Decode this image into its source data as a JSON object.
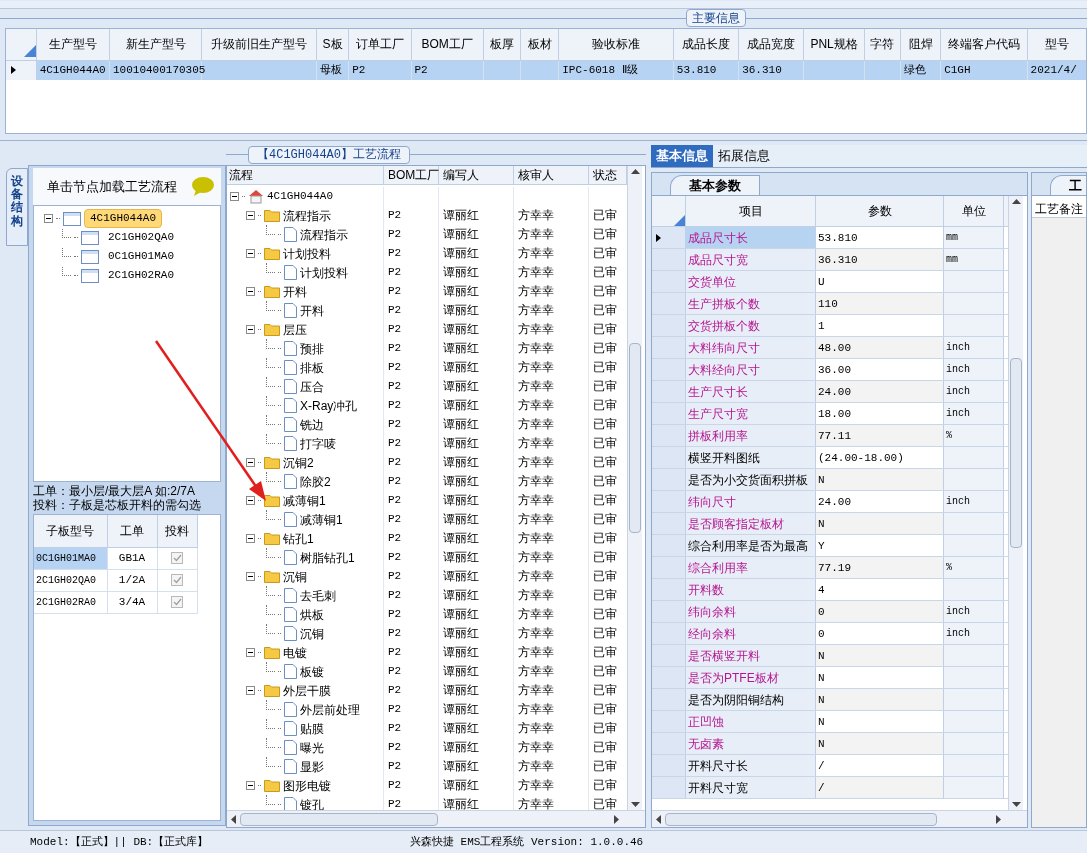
{
  "main_info": {
    "title": "主要信息",
    "columns": [
      "生产型号",
      "新生产型号",
      "升级前旧生产型号",
      "S板",
      "订单工厂",
      "BOM工厂",
      "板厚",
      "板材",
      "验收标准",
      "成品长度",
      "成品宽度",
      "PNL规格",
      "字符",
      "阻焊",
      "终端客户代码",
      "型号"
    ],
    "rows": [
      {
        "selected": true,
        "cells": [
          "4C1GH044A0",
          "10010400170305",
          null,
          "母板",
          "P2",
          "P2",
          null,
          null,
          "IPC-6018 Ⅱ级",
          "53.810",
          "36.310",
          null,
          null,
          "绿色",
          "C1GH",
          "2021/4/"
        ]
      }
    ]
  },
  "structure": {
    "tab": "设备结构",
    "hint": "单击节点加载工艺流程",
    "tree": [
      {
        "label": "4C1GH044A0",
        "selected": true,
        "expanded": true,
        "children": [
          {
            "label": "2C1GH02QA0",
            "selected": false
          },
          {
            "label": "0C1GH01MA0",
            "selected": false
          },
          {
            "label": "2C1GH02RA0",
            "selected": false
          }
        ]
      }
    ],
    "notes": [
      "工单：最小层/最大层A 如:2/7A",
      "投料：子板是芯板开料的需勾选"
    ],
    "sub_boards": {
      "columns": [
        "子板型号",
        "工单",
        "投料"
      ],
      "rows": [
        {
          "model": "0C1GH01MA0",
          "order": "GB1A",
          "checked": true,
          "selected": true
        },
        {
          "model": "2C1GH02QA0",
          "order": "1/2A",
          "checked": true,
          "selected": false
        },
        {
          "model": "2C1GH02RA0",
          "order": "3/4A",
          "checked": true,
          "selected": false
        }
      ]
    }
  },
  "process": {
    "title": "【4C1GH044A0】工艺流程",
    "columns": [
      "流程",
      "BOM工厂",
      "编写人",
      "核审人",
      "状态"
    ],
    "tree": [
      {
        "label": "4C1GH044A0",
        "kind": "root",
        "expanded": true,
        "children": [
          {
            "label": "流程指示",
            "kind": "folder",
            "expanded": true,
            "bom": "P2",
            "writer": "谭丽红",
            "reviewer": "方幸幸",
            "status": "已审",
            "children": [
              {
                "label": "流程指示",
                "kind": "step",
                "bom": "P2",
                "writer": "谭丽红",
                "reviewer": "方幸幸",
                "status": "已审"
              }
            ]
          },
          {
            "label": "计划投料",
            "kind": "folder",
            "expanded": true,
            "bom": "P2",
            "writer": "谭丽红",
            "reviewer": "方幸幸",
            "status": "已审",
            "children": [
              {
                "label": "计划投料",
                "kind": "step",
                "bom": "P2",
                "writer": "谭丽红",
                "reviewer": "方幸幸",
                "status": "已审"
              }
            ]
          },
          {
            "label": "开料",
            "kind": "folder",
            "expanded": true,
            "bom": "P2",
            "writer": "谭丽红",
            "reviewer": "方幸幸",
            "status": "已审",
            "children": [
              {
                "label": "开料",
                "kind": "step",
                "bom": "P2",
                "writer": "谭丽红",
                "reviewer": "方幸幸",
                "status": "已审"
              }
            ]
          },
          {
            "label": "层压",
            "kind": "folder",
            "expanded": true,
            "bom": "P2",
            "writer": "谭丽红",
            "reviewer": "方幸幸",
            "status": "已审",
            "children": [
              {
                "label": "预排",
                "kind": "step",
                "bom": "P2",
                "writer": "谭丽红",
                "reviewer": "方幸幸",
                "status": "已审"
              },
              {
                "label": "排板",
                "kind": "step",
                "bom": "P2",
                "writer": "谭丽红",
                "reviewer": "方幸幸",
                "status": "已审"
              },
              {
                "label": "压合",
                "kind": "step",
                "bom": "P2",
                "writer": "谭丽红",
                "reviewer": "方幸幸",
                "status": "已审"
              },
              {
                "label": "X-Ray冲孔",
                "kind": "step",
                "bom": "P2",
                "writer": "谭丽红",
                "reviewer": "方幸幸",
                "status": "已审"
              },
              {
                "label": "铣边",
                "kind": "step",
                "bom": "P2",
                "writer": "谭丽红",
                "reviewer": "方幸幸",
                "status": "已审"
              },
              {
                "label": "打字唛",
                "kind": "step",
                "bom": "P2",
                "writer": "谭丽红",
                "reviewer": "方幸幸",
                "status": "已审"
              }
            ]
          },
          {
            "label": "沉铜2",
            "kind": "folder",
            "expanded": true,
            "bom": "P2",
            "writer": "谭丽红",
            "reviewer": "方幸幸",
            "status": "已审",
            "children": [
              {
                "label": "除胶2",
                "kind": "step",
                "bom": "P2",
                "writer": "谭丽红",
                "reviewer": "方幸幸",
                "status": "已审"
              }
            ]
          },
          {
            "label": "减薄铜1",
            "kind": "folder",
            "expanded": true,
            "bom": "P2",
            "writer": "谭丽红",
            "reviewer": "方幸幸",
            "status": "已审",
            "children": [
              {
                "label": "减薄铜1",
                "kind": "step",
                "bom": "P2",
                "writer": "谭丽红",
                "reviewer": "方幸幸",
                "status": "已审"
              }
            ]
          },
          {
            "label": "钻孔1",
            "kind": "folder",
            "expanded": true,
            "bom": "P2",
            "writer": "谭丽红",
            "reviewer": "方幸幸",
            "status": "已审",
            "children": [
              {
                "label": "树脂钻孔1",
                "kind": "step",
                "bom": "P2",
                "writer": "谭丽红",
                "reviewer": "方幸幸",
                "status": "已审"
              }
            ]
          },
          {
            "label": "沉铜",
            "kind": "folder",
            "expanded": true,
            "bom": "P2",
            "writer": "谭丽红",
            "reviewer": "方幸幸",
            "status": "已审",
            "children": [
              {
                "label": "去毛刺",
                "kind": "step",
                "bom": "P2",
                "writer": "谭丽红",
                "reviewer": "方幸幸",
                "status": "已审"
              },
              {
                "label": "烘板",
                "kind": "step",
                "bom": "P2",
                "writer": "谭丽红",
                "reviewer": "方幸幸",
                "status": "已审"
              },
              {
                "label": "沉铜",
                "kind": "step",
                "bom": "P2",
                "writer": "谭丽红",
                "reviewer": "方幸幸",
                "status": "已审"
              }
            ]
          },
          {
            "label": "电镀",
            "kind": "folder",
            "expanded": true,
            "bom": "P2",
            "writer": "谭丽红",
            "reviewer": "方幸幸",
            "status": "已审",
            "children": [
              {
                "label": "板镀",
                "kind": "step",
                "bom": "P2",
                "writer": "谭丽红",
                "reviewer": "方幸幸",
                "status": "已审"
              }
            ]
          },
          {
            "label": "外层干膜",
            "kind": "folder",
            "expanded": true,
            "bom": "P2",
            "writer": "谭丽红",
            "reviewer": "方幸幸",
            "status": "已审",
            "children": [
              {
                "label": "外层前处理",
                "kind": "step",
                "bom": "P2",
                "writer": "谭丽红",
                "reviewer": "方幸幸",
                "status": "已审"
              },
              {
                "label": "贴膜",
                "kind": "step",
                "bom": "P2",
                "writer": "谭丽红",
                "reviewer": "方幸幸",
                "status": "已审"
              },
              {
                "label": "曝光",
                "kind": "step",
                "bom": "P2",
                "writer": "谭丽红",
                "reviewer": "方幸幸",
                "status": "已审"
              },
              {
                "label": "显影",
                "kind": "step",
                "bom": "P2",
                "writer": "谭丽红",
                "reviewer": "方幸幸",
                "status": "已审"
              }
            ]
          },
          {
            "label": "图形电镀",
            "kind": "folder",
            "expanded": true,
            "bom": "P2",
            "writer": "谭丽红",
            "reviewer": "方幸幸",
            "status": "已审",
            "children": [
              {
                "label": "镀孔",
                "kind": "step",
                "bom": "P2",
                "writer": "谭丽红",
                "reviewer": "方幸幸",
                "status": "已审"
              }
            ]
          }
        ]
      }
    ]
  },
  "info": {
    "tabs": [
      {
        "label": "基本信息",
        "selected": true
      },
      {
        "label": "拓展信息",
        "selected": false
      }
    ],
    "params_tab": "基本参数",
    "columns": [
      "项目",
      "参数",
      "单位"
    ],
    "params": [
      {
        "item": "成品尺寸长",
        "value": "53.810",
        "unit": "mm",
        "highlighted": true,
        "selected": true
      },
      {
        "item": "成品尺寸宽",
        "value": "36.310",
        "unit": "mm",
        "highlighted": true,
        "selected": false
      },
      {
        "item": "交货单位",
        "value": "U",
        "highlighted": true,
        "selected": false
      },
      {
        "item": "生产拼板个数",
        "value": "110",
        "highlighted": true,
        "selected": false
      },
      {
        "item": "交货拼板个数",
        "value": "1",
        "highlighted": true,
        "selected": false
      },
      {
        "item": "大料纬向尺寸",
        "value": "48.00",
        "unit": "inch",
        "highlighted": true,
        "selected": false
      },
      {
        "item": "大料经向尺寸",
        "value": "36.00",
        "unit": "inch",
        "highlighted": true,
        "selected": false
      },
      {
        "item": "生产尺寸长",
        "value": "24.00",
        "unit": "inch",
        "highlighted": true,
        "selected": false
      },
      {
        "item": "生产尺寸宽",
        "value": "18.00",
        "unit": "inch",
        "highlighted": true,
        "selected": false
      },
      {
        "item": "拼板利用率",
        "value": "77.11",
        "unit": "%",
        "highlighted": true,
        "selected": false
      },
      {
        "item": "横竖开料图纸",
        "value": "(24.00-18.00)",
        "highlighted": false,
        "selected": false
      },
      {
        "item": "是否为小交货面积拼板",
        "value": "N",
        "highlighted": false,
        "selected": false
      },
      {
        "item": "纬向尺寸",
        "value": "24.00",
        "unit": "inch",
        "highlighted": true,
        "selected": false
      },
      {
        "item": "是否顾客指定板材",
        "value": "N",
        "highlighted": true,
        "selected": false
      },
      {
        "item": "综合利用率是否为最高",
        "value": "Y",
        "highlighted": false,
        "selected": false
      },
      {
        "item": "综合利用率",
        "value": "77.19",
        "unit": "%",
        "highlighted": true,
        "selected": false
      },
      {
        "item": "开料数",
        "value": "4",
        "highlighted": true,
        "selected": false
      },
      {
        "item": "纬向余料",
        "value": "0",
        "unit": "inch",
        "highlighted": true,
        "selected": false
      },
      {
        "item": "经向余料",
        "value": "0",
        "unit": "inch",
        "highlighted": true,
        "selected": false
      },
      {
        "item": "是否横竖开料",
        "value": "N",
        "highlighted": true,
        "selected": false
      },
      {
        "item": "是否为PTFE板材",
        "value": "N",
        "highlighted": true,
        "selected": false
      },
      {
        "item": "是否为阴阳铜结构",
        "value": "N",
        "highlighted": false,
        "selected": false
      },
      {
        "item": "正凹蚀",
        "value": "N",
        "highlighted": true,
        "selected": false
      },
      {
        "item": "无卤素",
        "value": "N",
        "highlighted": true,
        "selected": false
      },
      {
        "item": "开料尺寸长",
        "value": "/",
        "highlighted": false,
        "selected": false
      },
      {
        "item": "开料尺寸宽",
        "value": "/",
        "highlighted": false,
        "selected": false
      }
    ],
    "side_tab": "工",
    "side_label": "工艺备注"
  },
  "status_bar": {
    "left": "Model:【正式】|| DB:【正式库】",
    "center": "兴森快捷 EMS工程系统 Version: 1.0.0.46"
  }
}
